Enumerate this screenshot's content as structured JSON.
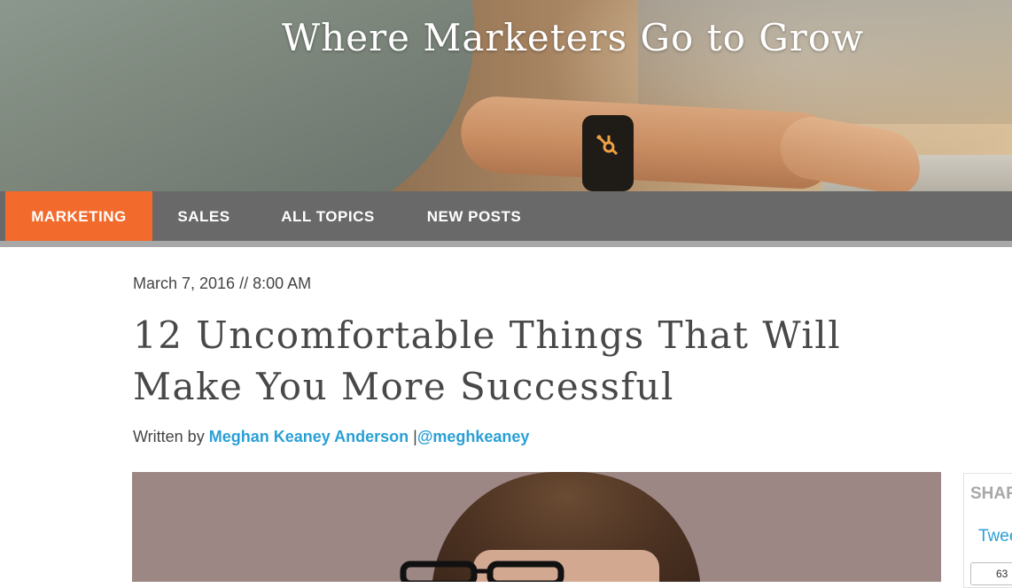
{
  "hero": {
    "title": "Where Marketers Go to Grow"
  },
  "nav": {
    "items": [
      {
        "label": "MARKETING",
        "active": true
      },
      {
        "label": "SALES",
        "active": false
      },
      {
        "label": "ALL TOPICS",
        "active": false
      },
      {
        "label": "NEW POSTS",
        "active": false
      }
    ]
  },
  "post": {
    "date": "March 7, 2016 // 8:00 AM",
    "title": "12 Uncomfortable Things That Will Make You More Successful",
    "byline_prefix": "Written by",
    "author": "Meghan Keaney Anderson",
    "separator": "|",
    "handle": "@meghkeaney"
  },
  "share": {
    "title": "SHARE",
    "tweet": "Tweet",
    "count": "63"
  },
  "colors": {
    "accent": "#f26a2c",
    "nav_bg": "#696969",
    "link": "#2a9fd6",
    "text": "#484848"
  }
}
